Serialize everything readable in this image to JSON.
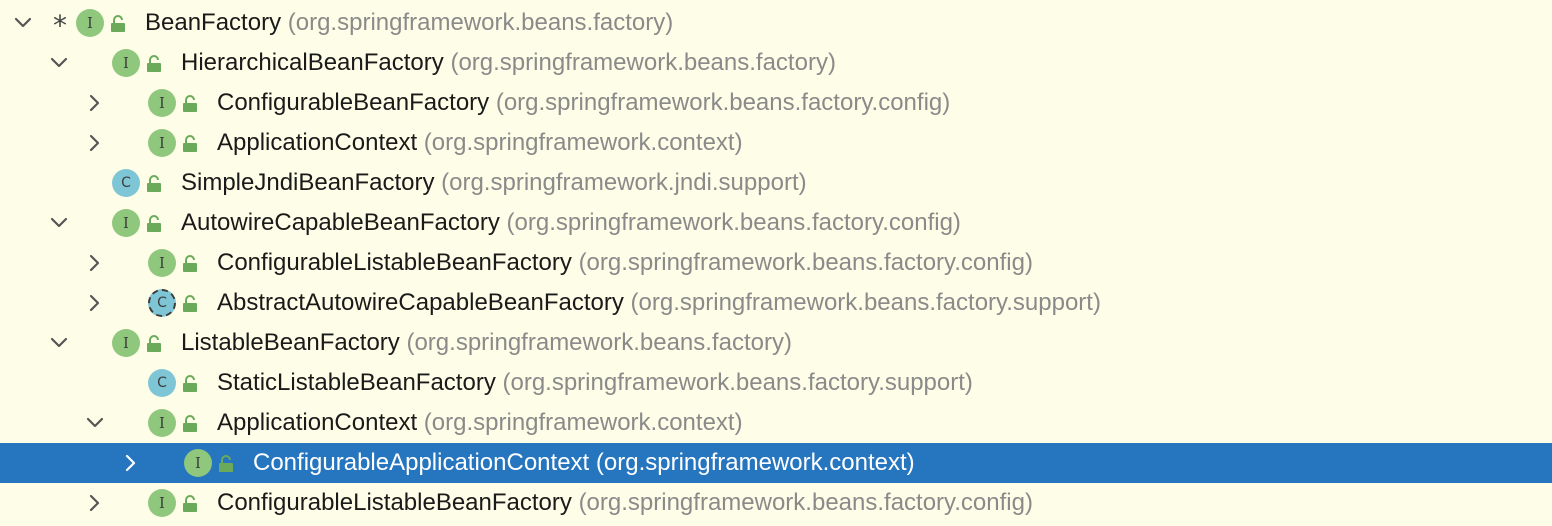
{
  "colors": {
    "background": "#fefee8",
    "selection": "#2675bf",
    "interface_badge": "#8fc77c",
    "class_badge": "#7ec6d6",
    "lock_icon": "#6aaa5a",
    "package_text": "#8a8a8a"
  },
  "tree": [
    {
      "depth": 0,
      "toggle": "expanded",
      "marker": "*",
      "kind": "I",
      "icon": "interface-icon",
      "name": "BeanFactory",
      "package": "(org.springframework.beans.factory)",
      "selected": false
    },
    {
      "depth": 1,
      "toggle": "expanded",
      "kind": "I",
      "icon": "interface-icon",
      "name": "HierarchicalBeanFactory",
      "package": "(org.springframework.beans.factory)",
      "selected": false
    },
    {
      "depth": 2,
      "toggle": "collapsed",
      "kind": "I",
      "icon": "interface-icon",
      "name": "ConfigurableBeanFactory",
      "package": "(org.springframework.beans.factory.config)",
      "selected": false
    },
    {
      "depth": 2,
      "toggle": "collapsed",
      "kind": "I",
      "icon": "interface-icon",
      "name": "ApplicationContext",
      "package": "(org.springframework.context)",
      "selected": false
    },
    {
      "depth": 1,
      "toggle": "none",
      "kind": "C",
      "icon": "class-icon",
      "name": "SimpleJndiBeanFactory",
      "package": "(org.springframework.jndi.support)",
      "selected": false
    },
    {
      "depth": 1,
      "toggle": "expanded",
      "kind": "I",
      "icon": "interface-icon",
      "name": "AutowireCapableBeanFactory",
      "package": "(org.springframework.beans.factory.config)",
      "selected": false
    },
    {
      "depth": 2,
      "toggle": "collapsed",
      "kind": "I",
      "icon": "interface-icon",
      "name": "ConfigurableListableBeanFactory",
      "package": "(org.springframework.beans.factory.config)",
      "selected": false
    },
    {
      "depth": 2,
      "toggle": "collapsed",
      "kind": "AC",
      "icon": "abstract-class-icon",
      "name": "AbstractAutowireCapableBeanFactory",
      "package": "(org.springframework.beans.factory.support)",
      "selected": false
    },
    {
      "depth": 1,
      "toggle": "expanded",
      "kind": "I",
      "icon": "interface-icon",
      "name": "ListableBeanFactory",
      "package": "(org.springframework.beans.factory)",
      "selected": false
    },
    {
      "depth": 2,
      "toggle": "none",
      "kind": "C",
      "icon": "class-icon",
      "name": "StaticListableBeanFactory",
      "package": "(org.springframework.beans.factory.support)",
      "selected": false
    },
    {
      "depth": 2,
      "toggle": "expanded",
      "kind": "I",
      "icon": "interface-icon",
      "name": "ApplicationContext",
      "package": "(org.springframework.context)",
      "selected": false
    },
    {
      "depth": 3,
      "toggle": "collapsed",
      "kind": "I",
      "icon": "interface-icon",
      "name": "ConfigurableApplicationContext",
      "package": "(org.springframework.context)",
      "selected": true
    },
    {
      "depth": 2,
      "toggle": "collapsed",
      "kind": "I",
      "icon": "interface-icon",
      "name": "ConfigurableListableBeanFactory",
      "package": "(org.springframework.beans.factory.config)",
      "selected": false
    }
  ]
}
